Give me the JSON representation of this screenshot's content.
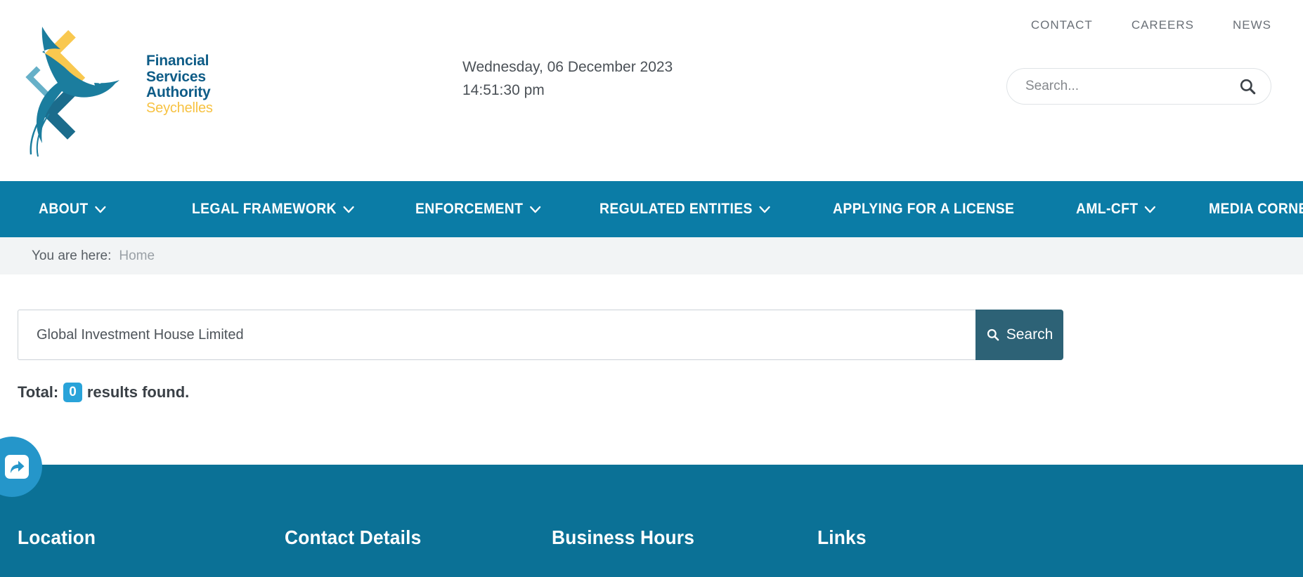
{
  "site": {
    "logo": {
      "line1": "Financial",
      "line2": "Services",
      "line3": "Authority",
      "line4": "Seychelles",
      "mark_icon": "bird-diamond-logo-icon",
      "brand_blue": "#0e5c87",
      "brand_yellow": "#f7c242"
    },
    "datetime": {
      "date": "Wednesday, 06 December 2023",
      "time": "14:51:30 pm"
    },
    "top_links": [
      {
        "label": "CONTACT",
        "name": "top-link-contact"
      },
      {
        "label": "CAREERS",
        "name": "top-link-careers"
      },
      {
        "label": "NEWS",
        "name": "top-link-news"
      }
    ],
    "header_search": {
      "placeholder": "Search...",
      "value": "",
      "icon": "search-icon"
    }
  },
  "nav": {
    "background": "#0b7ca6",
    "items": [
      {
        "label": "ABOUT",
        "has_dropdown": true
      },
      {
        "label": "LEGAL FRAMEWORK",
        "has_dropdown": true
      },
      {
        "label": "ENFORCEMENT",
        "has_dropdown": true
      },
      {
        "label": "REGULATED ENTITIES",
        "has_dropdown": true
      },
      {
        "label": "APPLYING FOR A LICENSE",
        "has_dropdown": false
      },
      {
        "label": "AML-CFT",
        "has_dropdown": true
      },
      {
        "label": "MEDIA CORNER",
        "has_dropdown": true
      }
    ]
  },
  "breadcrumb": {
    "label": "You are here:",
    "current": "Home"
  },
  "main": {
    "search": {
      "value": "Global Investment House Limited",
      "placeholder": "",
      "button_label": "Search",
      "button_icon": "search-icon",
      "button_color": "#2d6276"
    },
    "results": {
      "prefix": "Total:",
      "count": "0",
      "suffix": "results found.",
      "badge_color": "#29a3d9"
    }
  },
  "footer": {
    "background": "#0b7196",
    "columns": [
      {
        "heading": "Location"
      },
      {
        "heading": "Contact Details"
      },
      {
        "heading": "Business Hours"
      },
      {
        "heading": "Links"
      }
    ],
    "share_widget": {
      "icon": "share-arrow-icon",
      "color": "#2596ca"
    }
  }
}
